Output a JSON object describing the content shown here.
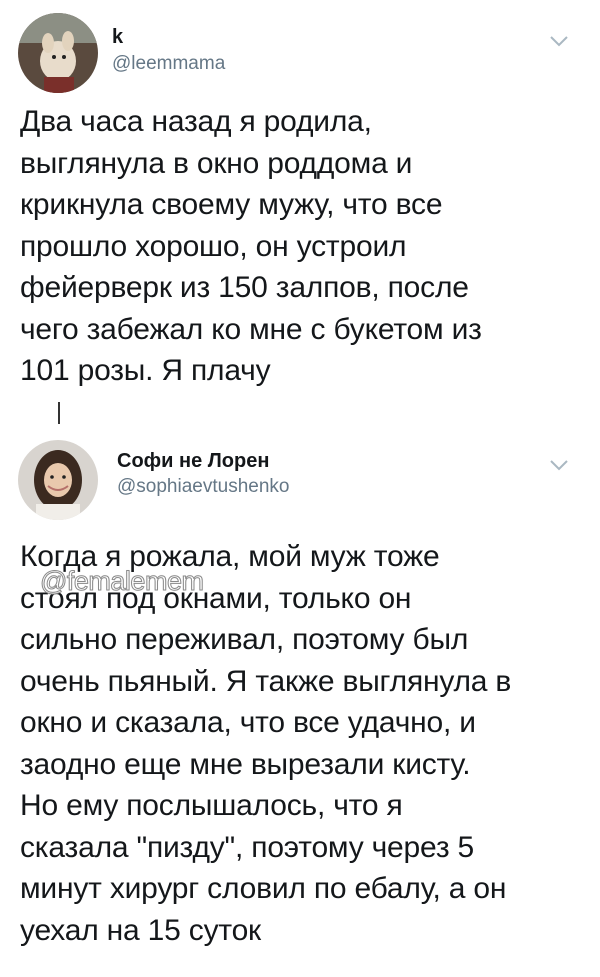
{
  "tweets": [
    {
      "display_name": "k",
      "handle": "@leemmama",
      "text": "Два часа назад я родила,\nвыглянула в окно роддома и\nкрикнула своему мужу, что все\nпрошло хорошо, он устроил\nфейерверк из 150 залпов, после\nчего забежал ко мне с букетом из\n101 розы. Я плачу",
      "menu_icon": "chevron-down-icon"
    },
    {
      "display_name": "Софи не Лорен",
      "handle": "@sophiaevtushenko",
      "text": "Когда я рожала, мой муж тоже\nстоял под окнами, только он\nсильно переживал, поэтому был\nочень пьяный. Я также выглянула в\nокно и сказала, что все удачно, и\nзаодно еще мне вырезали кисту.\nНо ему послышалось, что я\nсказала \"пизду\", поэтому через 5\nминут хирург словил по ебалу, а он\nуехал на 15 суток",
      "menu_icon": "chevron-down-icon"
    }
  ],
  "watermark": "@femalemem",
  "colors": {
    "handle": "#657786",
    "text": "#14171a",
    "chevron": "#aab8c2"
  }
}
